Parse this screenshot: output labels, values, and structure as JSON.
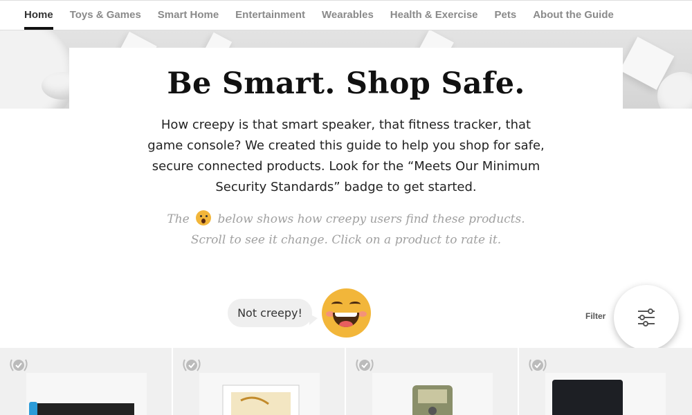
{
  "nav": {
    "items": [
      {
        "label": "Home",
        "active": true
      },
      {
        "label": "Toys & Games",
        "active": false
      },
      {
        "label": "Smart Home",
        "active": false
      },
      {
        "label": "Entertainment",
        "active": false
      },
      {
        "label": "Wearables",
        "active": false
      },
      {
        "label": "Health & Exercise",
        "active": false
      },
      {
        "label": "Pets",
        "active": false
      },
      {
        "label": "About the Guide",
        "active": false
      }
    ]
  },
  "hero": {
    "title": "Be Smart. Shop Safe.",
    "intro": "How creepy is that smart speaker, that fitness tracker, that game console? We created this guide to help you shop for safe, secure connected products. Look for the “Meets Our Minimum Security Standards” badge to get started.",
    "hint_before": "The",
    "hint_after": "below shows how creepy users find these products. Scroll to see it change. Click on a product to rate it."
  },
  "creepiness": {
    "label": "Not creepy!",
    "face_icon": "grinning-face-icon",
    "face_color": "#f2b63a"
  },
  "filter": {
    "label": "Filter",
    "icon": "sliders-icon"
  },
  "products": [
    {
      "badge": "minimum-security-badge",
      "image": "game-console-handheld"
    },
    {
      "badge": "minimum-security-badge",
      "image": "harry-potter-coding-kit"
    },
    {
      "badge": "minimum-security-badge",
      "image": "toy-robot-package"
    },
    {
      "badge": "minimum-security-badge",
      "image": "game-console"
    }
  ],
  "colors": {
    "accent": "#111111",
    "nav_inactive": "#8a8a8a",
    "tile_bg": "#f0f0f0",
    "hint_text": "#a0a0a0"
  }
}
